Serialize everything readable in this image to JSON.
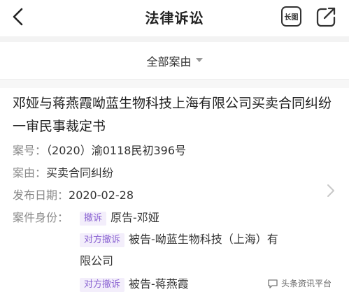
{
  "nav": {
    "title": "法律诉讼",
    "long_image_label": "长图"
  },
  "filter": {
    "label": "全部案由"
  },
  "case": {
    "title": "邓娅与蒋燕霞呦蓝生物科技上海有限公司买卖合同纠纷一审民事裁定书",
    "case_no_key": "案号：",
    "case_no_value": "（2020）渝0118民初396号",
    "cause_key": "案由：",
    "cause_value": "买卖合同纠纷",
    "date_key": "发布日期：",
    "date_value": "2020-02-28",
    "identity_key": "案件身份：",
    "parties": [
      {
        "badge": "撤诉",
        "text": "原告-邓娅"
      },
      {
        "badge": "对方撤诉",
        "text_line1": "被告-呦蓝生物科技（上海）有",
        "text_line2": "限公司"
      },
      {
        "badge": "对方撤诉",
        "text": "被告-蒋燕霞"
      }
    ]
  },
  "watermark": {
    "text": "头条资讯平台"
  },
  "colors": {
    "badge_bg": "#f3eefb",
    "badge_text": "#8a63d2",
    "key_text": "#8a8a8a",
    "section_gap": "#f3f3f3"
  }
}
